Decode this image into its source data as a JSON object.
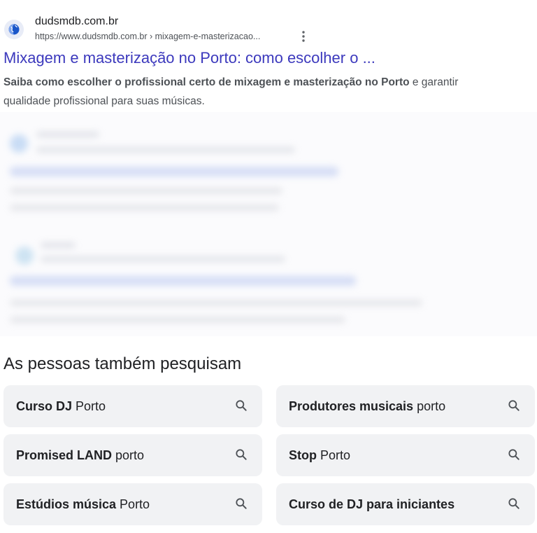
{
  "result": {
    "favicon": "globe-icon",
    "site_name": "dudsmdb.com.br",
    "url": "https://www.dudsmdb.com.br › mixagem-e-masterizacao...",
    "title": "Mixagem e masterização no Porto: como escolher o ...",
    "snippet_bold": "Saiba como escolher o profissional certo de mixagem e masterização no Porto",
    "snippet_rest": " e garantir qualidade profissional para suas músicas."
  },
  "people_also_search": {
    "heading": "As pessoas também pesquisam",
    "chips": [
      {
        "bold": "Curso DJ",
        "rest": "Porto"
      },
      {
        "bold": "Produtores musicais",
        "rest": "porto"
      },
      {
        "bold": "Promised LAND",
        "rest": "porto"
      },
      {
        "bold": "Stop",
        "rest": "Porto"
      },
      {
        "bold": "Estúdios música",
        "rest": "Porto"
      },
      {
        "bold": "Curso de DJ para iniciantes",
        "rest": ""
      }
    ]
  },
  "colors": {
    "title_link": "#3c39bd",
    "chip_bg": "#f1f2f4",
    "text": "#202124",
    "muted": "#4d5156"
  }
}
